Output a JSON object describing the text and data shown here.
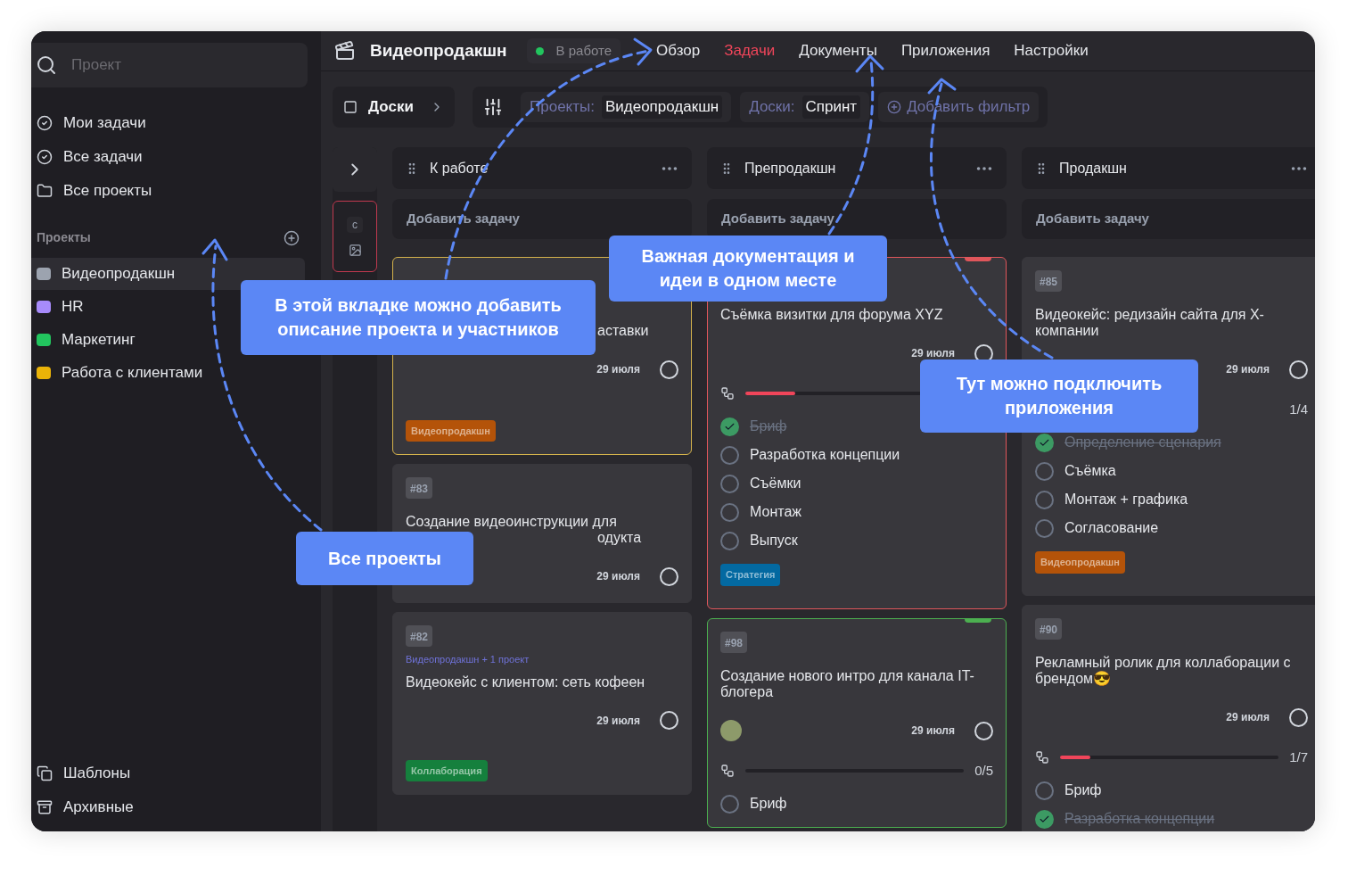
{
  "sidebar": {
    "search": {
      "placeholder": "Проект"
    },
    "nav": [
      {
        "label": "Мои задачи",
        "kind": "check"
      },
      {
        "label": "Все задачи",
        "kind": "check"
      },
      {
        "label": "Все проекты",
        "kind": "folder"
      }
    ],
    "projects_heading": "Проекты",
    "projects": [
      {
        "name": "Видеопродакшн",
        "selected": true,
        "color": "#9ca3af"
      },
      {
        "name": "HR",
        "selected": false,
        "color": "#a78bfa"
      },
      {
        "name": "Маркетинг",
        "selected": false,
        "color": "#22c55e"
      },
      {
        "name": "Работа с клиентами",
        "selected": false,
        "color": "#eab308"
      }
    ],
    "footer": [
      {
        "label": "Шаблоны",
        "kind": "template"
      },
      {
        "label": "Архивные",
        "kind": "archive"
      }
    ]
  },
  "header": {
    "title": "Видеопродакшн",
    "status": {
      "label": "В работе",
      "color": "#22c55e"
    },
    "tabs": [
      {
        "label": "Обзор",
        "selected": false
      },
      {
        "label": "Задачи",
        "selected": true
      },
      {
        "label": "Документы",
        "selected": false
      },
      {
        "label": "Приложения",
        "selected": false
      },
      {
        "label": "Настройки",
        "selected": false
      }
    ]
  },
  "toolbar": {
    "view": "Доски",
    "filters": [
      {
        "label": "Проекты:",
        "value": "Видеопродакшн"
      },
      {
        "label": "Доски:",
        "value": "Спринт"
      }
    ],
    "add_filter": "Добавить фильтр"
  },
  "collapsed_panel": {
    "letter": "c"
  },
  "columns": [
    {
      "title": "К работе",
      "add": "Добавить задачу",
      "cards": [
        {
          "color": "#d4b24c",
          "title_tail": "аставки",
          "date": "29 июля",
          "tag": {
            "label": "Видеопродакшн",
            "color": "#b45309"
          }
        },
        {
          "number": "#83",
          "title": "Создание видеоинструкции для",
          "title_tail": "одукта",
          "date": "29 июля"
        },
        {
          "number": "#82",
          "project_link": "Видеопродакшн + 1 проект",
          "title": "Видеокейс с клиентом: сеть кофеен",
          "date": "29 июля",
          "tag": {
            "label": "Коллаборация",
            "color": "#15803d"
          }
        }
      ]
    },
    {
      "title": "Препродакшн",
      "add": "Добавить задачу",
      "cards": [
        {
          "color": "#e0565b",
          "marker": true,
          "title": "Съёмка визитки для форума XYZ",
          "date": "29 июля",
          "progress": {
            "level": 0.2
          },
          "checklist": [
            {
              "label": "Бриф",
              "checked": true
            },
            {
              "label": "Разработка концепции",
              "checked": false
            },
            {
              "label": "Съёмки",
              "checked": false
            },
            {
              "label": "Монтаж",
              "checked": false
            },
            {
              "label": "Выпуск",
              "checked": false
            }
          ],
          "tag": {
            "label": "Стратегия",
            "color": "#0369a1"
          }
        },
        {
          "color": "#4caf50",
          "marker": true,
          "number": "#98",
          "title": "Создание нового интро для канала IT-блогера",
          "avatar": true,
          "date": "29 июля",
          "progress": {
            "level": 0,
            "count": "0/5"
          },
          "checklist": [
            {
              "label": "Бриф",
              "checked": false
            }
          ]
        }
      ]
    },
    {
      "title": "Продакшн",
      "add": "Добавить задачу",
      "cards": [
        {
          "number": "#85",
          "title": "Видеокейс: редизайн сайта для X-компании",
          "date": "29 июля",
          "progress": {
            "count": "1/4"
          },
          "checklist": [
            {
              "label": "Определение сценария",
              "checked": true
            },
            {
              "label": "Съёмка",
              "checked": false
            },
            {
              "label": "Монтаж + графика",
              "checked": false
            },
            {
              "label": "Согласование",
              "checked": false
            }
          ],
          "tag": {
            "label": "Видеопродакшн",
            "color": "#b45309"
          }
        },
        {
          "number": "#90",
          "title": "Рекламный ролик для коллаборации с брендом😎",
          "date": "29 июля",
          "progress": {
            "level": 0.14,
            "count": "1/7"
          },
          "checklist": [
            {
              "label": "Бриф",
              "checked": false
            },
            {
              "label": "Разработка концепции",
              "checked": true
            }
          ]
        }
      ]
    }
  ],
  "callouts": [
    {
      "text": "В этой вкладке можно добавить описание проекта и участников"
    },
    {
      "text": "Важная документация и идеи в одном месте"
    },
    {
      "text": "Тут можно подключить приложения"
    },
    {
      "text": "Все проекты"
    }
  ]
}
